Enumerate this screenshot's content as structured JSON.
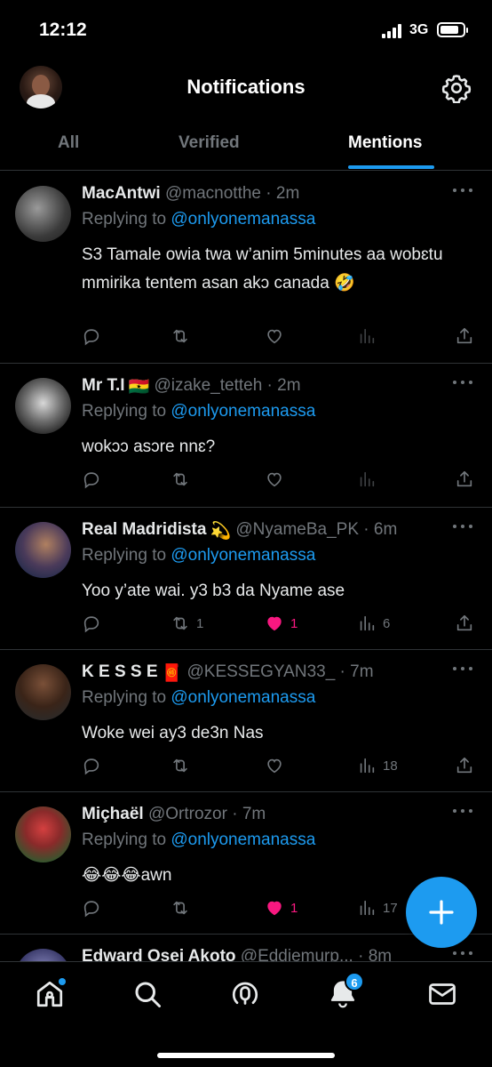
{
  "status_bar": {
    "time": "12:12",
    "network": "3G",
    "battery_level": 0.85
  },
  "header": {
    "title": "Notifications"
  },
  "tabs": [
    {
      "label": "All",
      "active": false
    },
    {
      "label": "Verified",
      "active": false
    },
    {
      "label": "Mentions",
      "active": true
    }
  ],
  "tweets": [
    {
      "name": "MacAntwi",
      "flag": "",
      "handle": "@macnotthe",
      "time": "2m",
      "reply_prefix": "Replying to",
      "reply_to": "@onlyonemanassa",
      "text": "S3 Tamale owia twa w’anim 5minutes aa wobɛtu mmirika tentem asan akɔ canada 🤣",
      "retweets": "",
      "likes": "",
      "liked": false,
      "views": ""
    },
    {
      "name": "Mr T.I",
      "flag": "🇬🇭",
      "handle": "@izake_tetteh",
      "time": "2m",
      "reply_prefix": "Replying to",
      "reply_to": "@onlyonemanassa",
      "text": "wokɔɔ asɔre nnɛ?",
      "retweets": "",
      "likes": "",
      "liked": false,
      "views": ""
    },
    {
      "name": "Real Madridista",
      "flag": "💫",
      "handle": "@NyameBa_PK",
      "time": "6m",
      "reply_prefix": "Replying to",
      "reply_to": "@onlyonemanassa",
      "text": "Yoo y’ate wai. y3 b3 da Nyame ase",
      "retweets": "1",
      "likes": "1",
      "liked": true,
      "views": "6"
    },
    {
      "name": "K E S S E",
      "flag": "🧧",
      "handle": "@KESSEGYAN33_",
      "time": "7m",
      "reply_prefix": "Replying to",
      "reply_to": "@onlyonemanassa",
      "text": "Woke wei ay3 de3n Nas",
      "retweets": "",
      "likes": "",
      "liked": false,
      "views": "18"
    },
    {
      "name": "Miçhaël",
      "flag": "",
      "handle": "@Ortrozor",
      "time": "7m",
      "reply_prefix": "Replying to",
      "reply_to": "@onlyonemanassa",
      "text": "😂😂😂awn",
      "retweets": "",
      "likes": "1",
      "liked": true,
      "views": "17"
    },
    {
      "name": "Edward Osei Akoto",
      "flag": "",
      "handle": "@Eddiemurp...",
      "time": "8m",
      "reply_prefix": "",
      "reply_to": "",
      "text": "",
      "retweets": "",
      "likes": "",
      "liked": false,
      "views": ""
    }
  ],
  "bottom_nav": {
    "items": [
      "home-icon",
      "search-icon",
      "spaces-icon",
      "notifications-icon",
      "messages-icon"
    ],
    "notification_badge": "6"
  },
  "colors": {
    "accent": "#1d9bf0",
    "like": "#f91880",
    "muted": "#71767b",
    "divider": "#2f3336"
  }
}
